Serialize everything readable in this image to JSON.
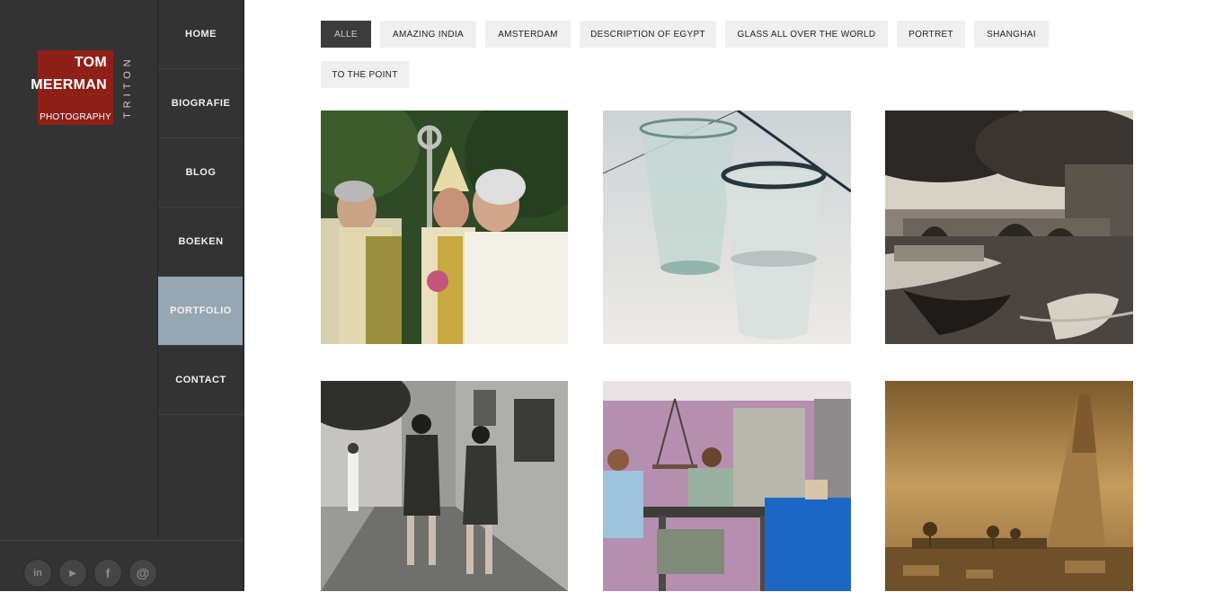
{
  "logo": {
    "line1": "TOM",
    "line2": "MEERMAN",
    "line3": "PHOTOGRAPHY",
    "vertical": "TRITON"
  },
  "nav": {
    "items": [
      {
        "label": "HOME"
      },
      {
        "label": "BIOGRAFIE"
      },
      {
        "label": "BLOG"
      },
      {
        "label": "BOEKEN"
      },
      {
        "label": "PORTFOLIO",
        "active": true
      },
      {
        "label": "CONTACT"
      }
    ]
  },
  "social": [
    {
      "icon": "linkedin-icon",
      "glyph": "in"
    },
    {
      "icon": "youtube-icon",
      "glyph": "▶"
    },
    {
      "icon": "facebook-icon",
      "glyph": "f"
    },
    {
      "icon": "email-icon",
      "glyph": "@"
    }
  ],
  "filters": [
    {
      "label": "ALLE",
      "active": true
    },
    {
      "label": "AMAZING INDIA"
    },
    {
      "label": "AMSTERDAM"
    },
    {
      "label": "DESCRIPTION OF EGYPT"
    },
    {
      "label": "GLASS ALL OVER THE WORLD"
    },
    {
      "label": "PORTRET"
    },
    {
      "label": "SHANGHAI"
    },
    {
      "label": "TO THE POINT"
    }
  ],
  "gallery": [
    {
      "subject": "bishop-procession"
    },
    {
      "subject": "two-water-glasses"
    },
    {
      "subject": "amsterdam-canal"
    },
    {
      "subject": "shanghai-street-women"
    },
    {
      "subject": "men-at-table-pink-room"
    },
    {
      "subject": "egypt-ruins-sepia"
    }
  ],
  "colors": {
    "sidebar": "#333333",
    "logo_red": "#8e2018",
    "nav_active": "#96a6b2",
    "filter_bg": "#efefef",
    "filter_active": "#3c3c3c"
  }
}
